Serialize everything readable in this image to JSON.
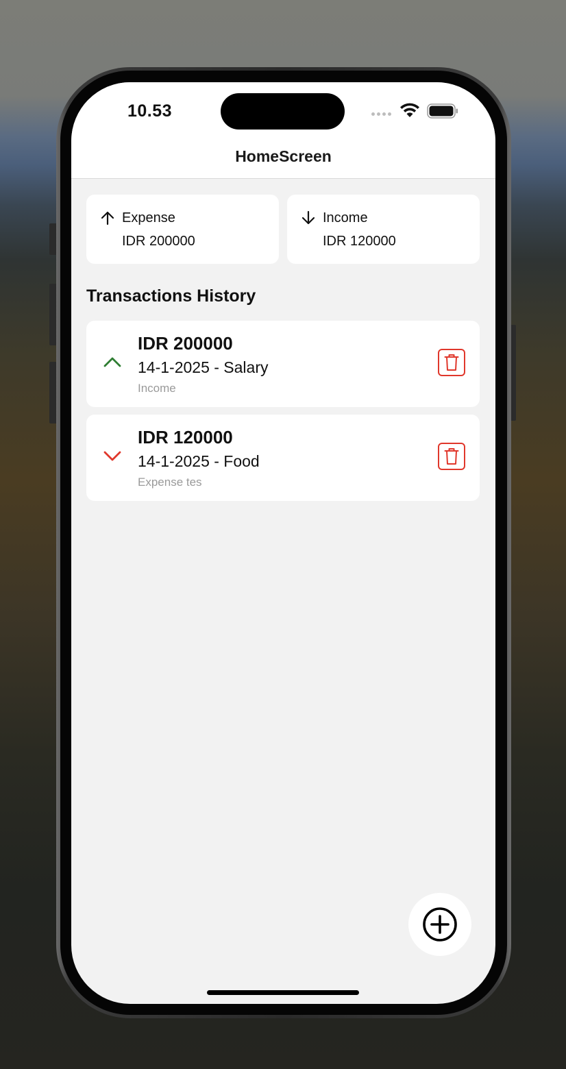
{
  "status_bar": {
    "time": "10.53"
  },
  "nav": {
    "title": "HomeScreen"
  },
  "summary": {
    "expense": {
      "label": "Expense",
      "value": "IDR 200000",
      "icon": "arrow-up-icon"
    },
    "income": {
      "label": "Income",
      "value": "IDR 120000",
      "icon": "arrow-down-icon"
    }
  },
  "history": {
    "title": "Transactions History",
    "items": [
      {
        "amount": "IDR 200000",
        "description": "14-1-2025 - Salary",
        "note": "Income",
        "direction": "up",
        "icon": "chevron-up-icon",
        "color": "#2e7d32"
      },
      {
        "amount": "IDR 120000",
        "description": "14-1-2025 - Food",
        "note": "Expense tes",
        "direction": "down",
        "icon": "chevron-down-icon",
        "color": "#e0372b"
      }
    ]
  },
  "colors": {
    "delete": "#e0372b",
    "income_up": "#2e7d32",
    "expense_down": "#e0372b",
    "background": "#f2f2f2"
  },
  "fab": {
    "icon": "add-circle-icon"
  }
}
